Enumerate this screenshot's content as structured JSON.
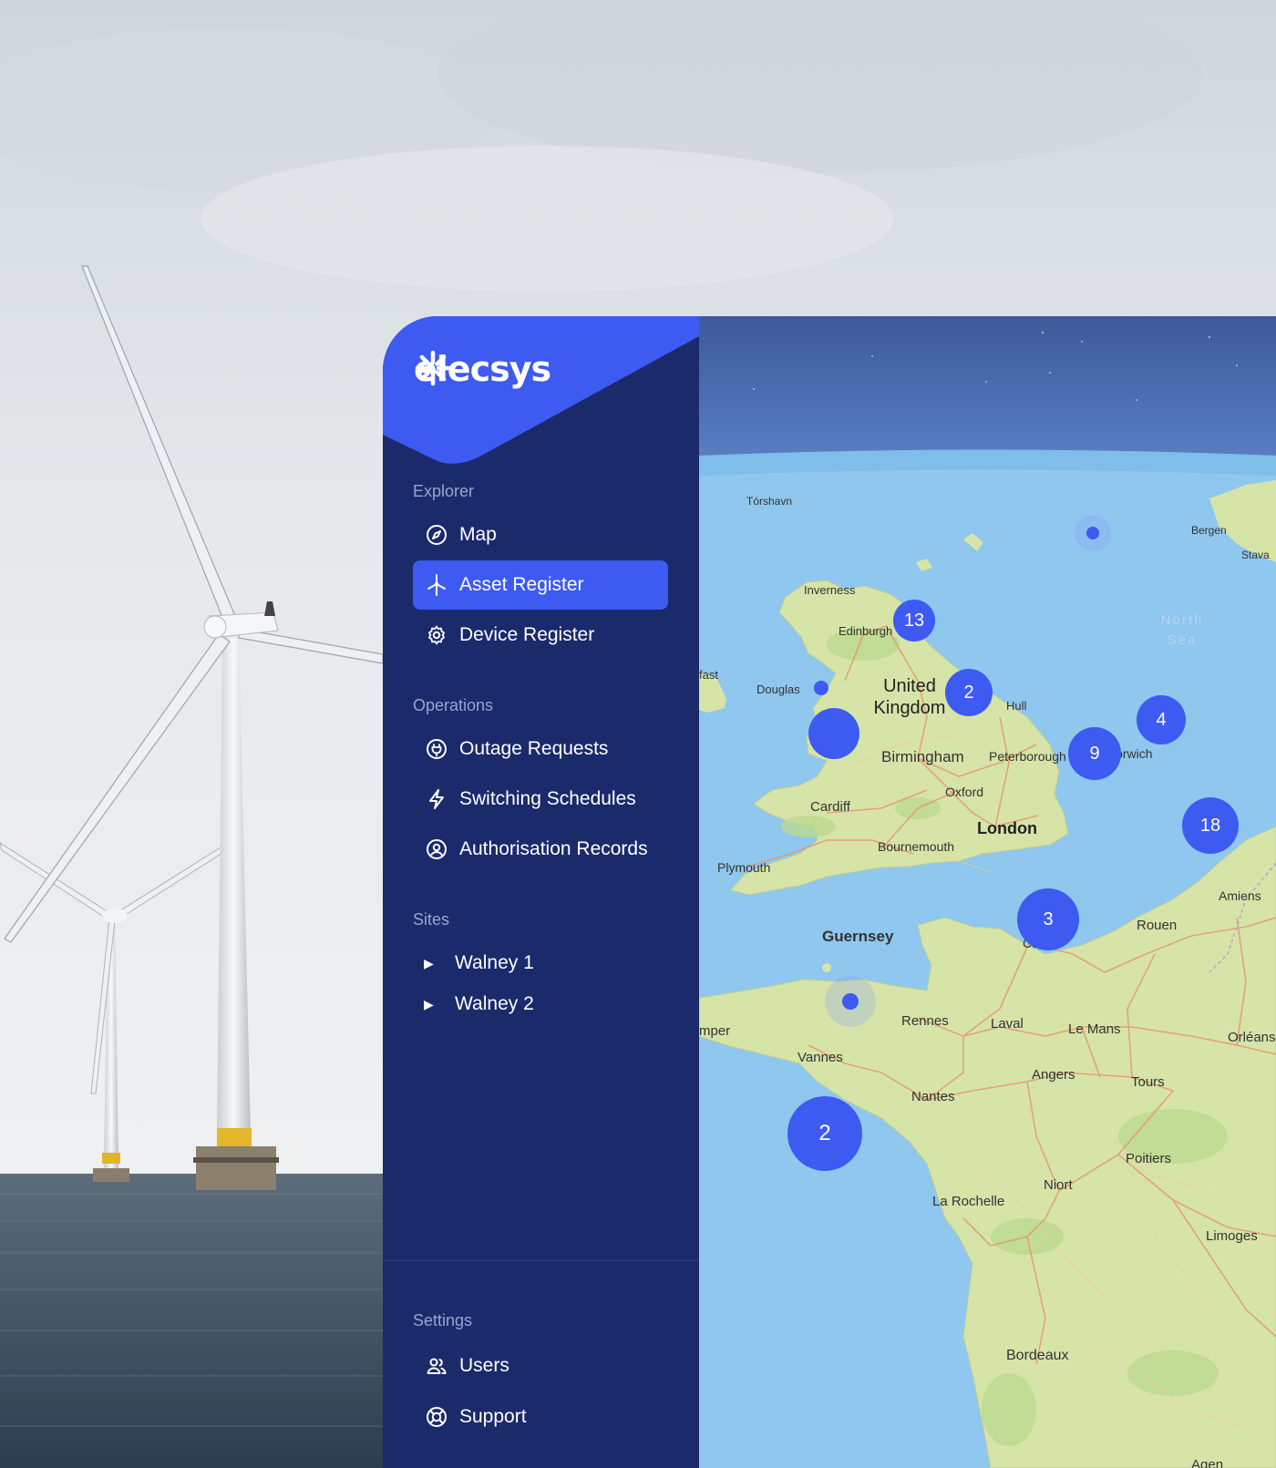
{
  "brand": {
    "name": "elecsys",
    "logo_icon": "asterisk-spark-icon"
  },
  "colors": {
    "sidebar": "#1b2a6b",
    "accent": "#3d5af1",
    "muted_label": "#9aa4cf",
    "sea": "#8fc7ee",
    "land": "#d6e4a8"
  },
  "sidebar": {
    "explorer": {
      "label": "Explorer",
      "items": [
        {
          "label": "Map",
          "icon": "compass-icon",
          "active": false
        },
        {
          "label": "Asset Register",
          "icon": "wind-turbine-icon",
          "active": true
        },
        {
          "label": "Device Register",
          "icon": "gear-icon",
          "active": false
        }
      ]
    },
    "operations": {
      "label": "Operations",
      "items": [
        {
          "label": "Outage Requests",
          "icon": "plug-icon"
        },
        {
          "label": "Switching Schedules",
          "icon": "lightning-icon"
        },
        {
          "label": "Authorisation Records",
          "icon": "user-circle-icon"
        }
      ]
    },
    "sites": {
      "label": "Sites",
      "items": [
        {
          "label": "Walney 1",
          "icon": "caret-right-icon"
        },
        {
          "label": "Walney 2",
          "icon": "caret-right-icon"
        }
      ]
    },
    "settings": {
      "label": "Settings",
      "items": [
        {
          "label": "Users",
          "icon": "users-icon"
        },
        {
          "label": "Support",
          "icon": "lifebuoy-icon"
        }
      ]
    }
  },
  "map": {
    "clusters": [
      "13",
      "2",
      "4",
      "9",
      "18",
      "3",
      "2"
    ],
    "country_label": "United\nKingdom",
    "sea_label": "North\nSea",
    "cities": {
      "torshavn": "Tórshavn",
      "bergen": "Bergen",
      "stavanger": "Stava",
      "inverness": "Inverness",
      "edinburgh": "Edinburgh",
      "belfast": "fast",
      "douglas": "Douglas",
      "hull": "Hull",
      "birmingham": "Birmingham",
      "peterborough": "Peterborough",
      "norwich": "Norwich",
      "oxford": "Oxford",
      "cardiff": "Cardiff",
      "london": "London",
      "bournemouth": "Bournemouth",
      "plymouth": "Plymouth",
      "amiens": "Amiens",
      "rouen": "Rouen",
      "guernsey": "Guernsey",
      "caen": "Caen",
      "rennes": "Rennes",
      "laval": "Laval",
      "le_mans": "Le Mans",
      "orleans": "Orléans",
      "quimper": "mper",
      "vannes": "Vannes",
      "angers": "Angers",
      "tours": "Tours",
      "nantes": "Nantes",
      "poitiers": "Poitiers",
      "niort": "Niort",
      "la_rochelle": "La Rochelle",
      "limoges": "Limoges",
      "bordeaux": "Bordeaux",
      "agen": "Agen"
    }
  }
}
